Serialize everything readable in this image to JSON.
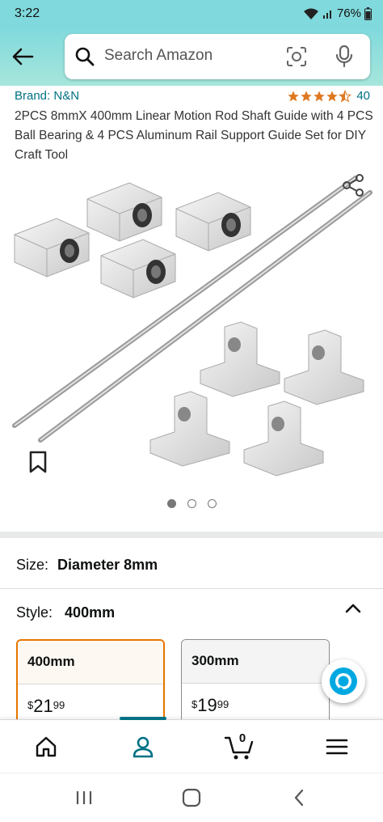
{
  "status_bar": {
    "time": "3:22",
    "battery": "76%"
  },
  "header": {
    "search_placeholder": "Search Amazon"
  },
  "product": {
    "brand_label": "Brand: N&N",
    "rating_stars": 4.5,
    "rating_count": "40",
    "title": "2PCS 8mmX 400mm Linear Motion Rod Shaft Guide with 4 PCS Ball Bearing & 4 PCS Aluminum Rail Support Guide Set for DIY Craft Tool",
    "image_count": 3,
    "active_image_index": 0
  },
  "size": {
    "label": "Size:",
    "value": "Diameter 8mm"
  },
  "style": {
    "label": "Style:",
    "value": "400mm",
    "options": [
      {
        "name": "400mm",
        "currency": "$",
        "whole": "21",
        "fraction": "99",
        "selected": true
      },
      {
        "name": "300mm",
        "currency": "$",
        "whole": "19",
        "fraction": "99",
        "selected": false
      }
    ]
  },
  "bottom_nav": {
    "cart_count": "0"
  },
  "colors": {
    "header": "#80d9dc",
    "link": "#007185",
    "star": "#de7921",
    "selected_border": "#e77600"
  }
}
